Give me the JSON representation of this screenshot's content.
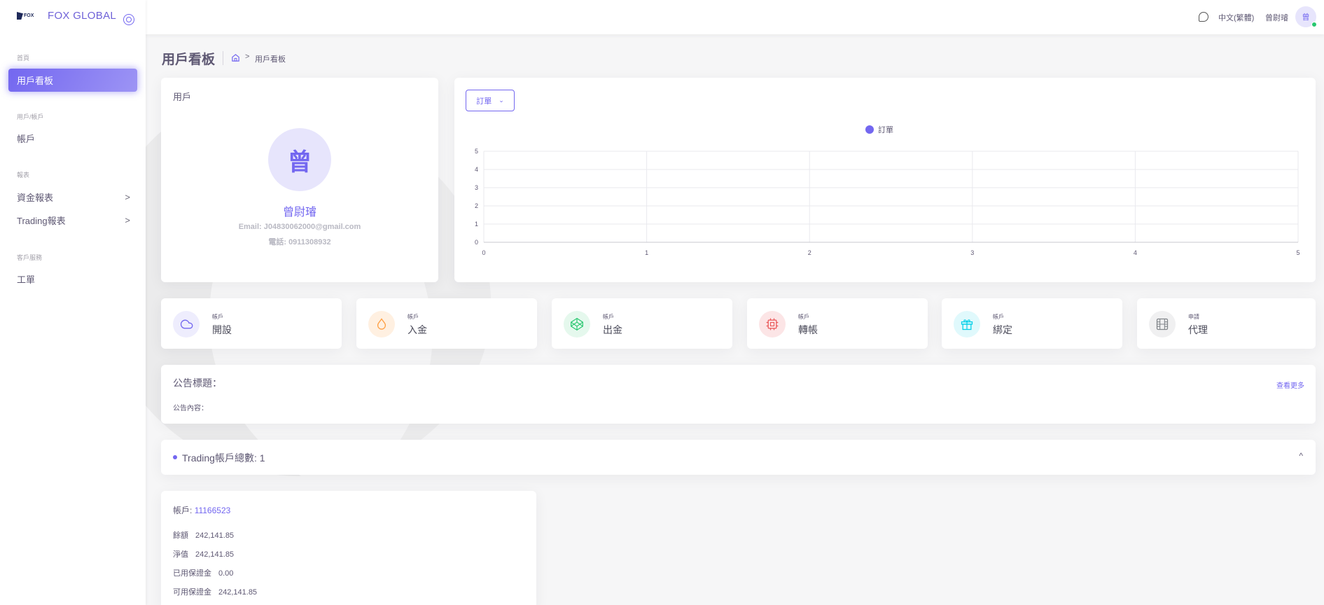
{
  "brand": {
    "logo_text": "FOX",
    "name": "FOX GLOBAL"
  },
  "sidebar": {
    "sections": [
      {
        "header": "首頁",
        "items": [
          {
            "label": "用戶看板",
            "active": true
          }
        ]
      },
      {
        "header": "用戶/帳戶",
        "items": [
          {
            "label": "帳戶"
          }
        ]
      },
      {
        "header": "報表",
        "items": [
          {
            "label": "資金報表",
            "chevron": ">"
          },
          {
            "label": "Trading報表",
            "chevron": ">"
          }
        ]
      },
      {
        "header": "客戶服務",
        "items": [
          {
            "label": "工單"
          }
        ]
      }
    ]
  },
  "navbar": {
    "language": "中文(繁體)",
    "user_name": "曾尉璿",
    "avatar_text": "曾"
  },
  "page": {
    "title": "用戶看板",
    "breadcrumb": "用戶看板",
    "breadcrumb_sep": ">"
  },
  "user_card": {
    "label": "用戶",
    "avatar_text": "曾",
    "name": "曾尉璿",
    "email": "Email: J04830062000@gmail.com",
    "phone": "電話: 0911308932"
  },
  "chart_data": {
    "type": "line",
    "select_label": "訂單",
    "legend": "訂單",
    "series": [
      {
        "name": "訂單",
        "values": []
      }
    ],
    "x_ticks": [
      "0",
      "1",
      "2",
      "3",
      "4",
      "5"
    ],
    "y_ticks": [
      "0",
      "1",
      "2",
      "3",
      "4",
      "5"
    ],
    "xlim": [
      0,
      5
    ],
    "ylim": [
      0,
      5
    ],
    "grid": true,
    "legend_position": "top-center",
    "color": "#7367f0"
  },
  "actions": [
    {
      "sub": "帳戶",
      "label": "開設",
      "icon": "cloud-icon",
      "color": "#7367f0",
      "bg": "#eeedfd"
    },
    {
      "sub": "帳戶",
      "label": "入金",
      "icon": "droplet-icon",
      "color": "#ff9f43",
      "bg": "#fff0e1"
    },
    {
      "sub": "帳戶",
      "label": "出金",
      "icon": "codepen-icon",
      "color": "#28c76f",
      "bg": "#e5f8ed"
    },
    {
      "sub": "帳戶",
      "label": "轉帳",
      "icon": "cpu-icon",
      "color": "#ea5455",
      "bg": "#fce5e6"
    },
    {
      "sub": "帳戶",
      "label": "綁定",
      "icon": "gift-icon",
      "color": "#00cfe8",
      "bg": "#e0f9fc"
    },
    {
      "sub": "申請",
      "label": "代理",
      "icon": "film-icon",
      "color": "#82868b",
      "bg": "#f0f0f1"
    }
  ],
  "notice": {
    "title": "公告標題：",
    "more": "查看更多",
    "content": "公告內容："
  },
  "trading": {
    "label": "Trading帳戶總數: 1",
    "chevron": "^"
  },
  "account": {
    "label": "帳戶:",
    "number": "11166523",
    "rows": [
      {
        "label": "餘額",
        "value": "242,141.85"
      },
      {
        "label": "淨值",
        "value": "242,141.85"
      },
      {
        "label": "已用保證金",
        "value": "0.00"
      },
      {
        "label": "可用保證金",
        "value": "242,141.85"
      }
    ]
  }
}
